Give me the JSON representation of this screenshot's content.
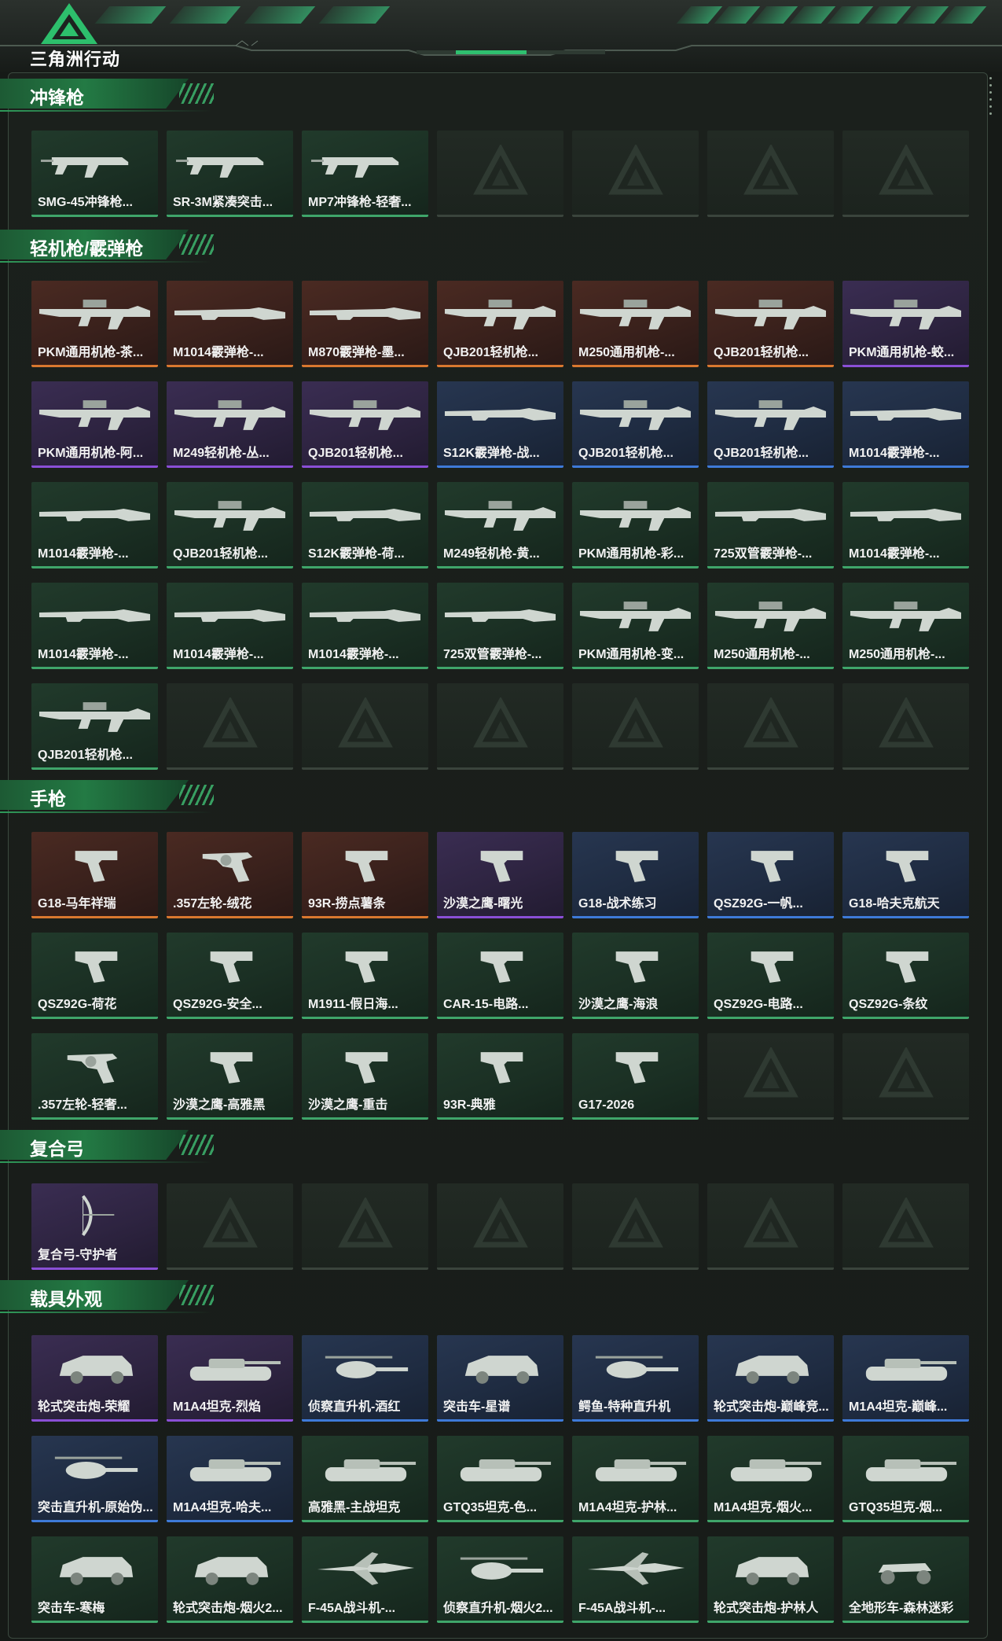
{
  "header": {
    "logo_text": "三角洲行动",
    "logo_icon": "delta-triangle-icon"
  },
  "colors": {
    "orange": "#d9782f",
    "purple": "#8a4fd6",
    "blue": "#3e7ad8",
    "green": "#3fa56a",
    "accent": "#237a44"
  },
  "sections": [
    {
      "title": "冲锋枪",
      "items": [
        {
          "name": "SMG-45冲锋枪...",
          "rarity": "green",
          "icon": "smg-icon"
        },
        {
          "name": "SR-3M紧凑突击...",
          "rarity": "green",
          "icon": "smg-icon"
        },
        {
          "name": "MP7冲锋枪-轻奢...",
          "rarity": "green",
          "icon": "smg-icon"
        },
        {
          "name": "",
          "rarity": "empty"
        },
        {
          "name": "",
          "rarity": "empty"
        },
        {
          "name": "",
          "rarity": "empty"
        },
        {
          "name": "",
          "rarity": "empty"
        }
      ]
    },
    {
      "title": "轻机枪/霰弹枪",
      "items": [
        {
          "name": "PKM通用机枪-茶...",
          "rarity": "orange",
          "icon": "machine-gun-icon"
        },
        {
          "name": "M1014霰弹枪-...",
          "rarity": "orange",
          "icon": "shotgun-icon"
        },
        {
          "name": "M870霰弹枪-墨...",
          "rarity": "orange",
          "icon": "shotgun-icon"
        },
        {
          "name": "QJB201轻机枪...",
          "rarity": "orange",
          "icon": "machine-gun-icon"
        },
        {
          "name": "M250通用机枪-...",
          "rarity": "orange",
          "icon": "machine-gun-icon"
        },
        {
          "name": "QJB201轻机枪...",
          "rarity": "orange",
          "icon": "machine-gun-icon"
        },
        {
          "name": "PKM通用机枪-蛟...",
          "rarity": "purple",
          "icon": "machine-gun-icon"
        },
        {
          "name": "PKM通用机枪-阿...",
          "rarity": "purple",
          "icon": "machine-gun-icon"
        },
        {
          "name": "M249轻机枪-丛...",
          "rarity": "purple",
          "icon": "machine-gun-icon"
        },
        {
          "name": "QJB201轻机枪...",
          "rarity": "purple",
          "icon": "machine-gun-icon"
        },
        {
          "name": "S12K霰弹枪-战...",
          "rarity": "blue",
          "icon": "shotgun-icon"
        },
        {
          "name": "QJB201轻机枪...",
          "rarity": "blue",
          "icon": "machine-gun-icon"
        },
        {
          "name": "QJB201轻机枪...",
          "rarity": "blue",
          "icon": "machine-gun-icon"
        },
        {
          "name": "M1014霰弹枪-...",
          "rarity": "blue",
          "icon": "shotgun-icon"
        },
        {
          "name": "M1014霰弹枪-...",
          "rarity": "green",
          "icon": "shotgun-icon"
        },
        {
          "name": "QJB201轻机枪...",
          "rarity": "green",
          "icon": "machine-gun-icon"
        },
        {
          "name": "S12K霰弹枪-荷...",
          "rarity": "green",
          "icon": "shotgun-icon"
        },
        {
          "name": "M249轻机枪-黄...",
          "rarity": "green",
          "icon": "machine-gun-icon"
        },
        {
          "name": "PKM通用机枪-彩...",
          "rarity": "green",
          "icon": "machine-gun-icon"
        },
        {
          "name": "725双管霰弹枪-...",
          "rarity": "green",
          "icon": "shotgun-icon"
        },
        {
          "name": "M1014霰弹枪-...",
          "rarity": "green",
          "icon": "shotgun-icon"
        },
        {
          "name": "M1014霰弹枪-...",
          "rarity": "green",
          "icon": "shotgun-icon"
        },
        {
          "name": "M1014霰弹枪-...",
          "rarity": "green",
          "icon": "shotgun-icon"
        },
        {
          "name": "M1014霰弹枪-...",
          "rarity": "green",
          "icon": "shotgun-icon"
        },
        {
          "name": "725双管霰弹枪-...",
          "rarity": "green",
          "icon": "shotgun-icon"
        },
        {
          "name": "PKM通用机枪-变...",
          "rarity": "green",
          "icon": "machine-gun-icon"
        },
        {
          "name": "M250通用机枪-...",
          "rarity": "green",
          "icon": "machine-gun-icon"
        },
        {
          "name": "M250通用机枪-...",
          "rarity": "green",
          "icon": "machine-gun-icon"
        },
        {
          "name": "QJB201轻机枪...",
          "rarity": "green",
          "icon": "machine-gun-icon"
        },
        {
          "name": "",
          "rarity": "empty"
        },
        {
          "name": "",
          "rarity": "empty"
        },
        {
          "name": "",
          "rarity": "empty"
        },
        {
          "name": "",
          "rarity": "empty"
        },
        {
          "name": "",
          "rarity": "empty"
        },
        {
          "name": "",
          "rarity": "empty"
        }
      ]
    },
    {
      "title": "手枪",
      "items": [
        {
          "name": "G18-马年祥瑞",
          "rarity": "orange",
          "icon": "pistol-icon"
        },
        {
          "name": ".357左轮-绒花",
          "rarity": "orange",
          "icon": "revolver-icon"
        },
        {
          "name": "93R-捞点薯条",
          "rarity": "orange",
          "icon": "pistol-icon"
        },
        {
          "name": "沙漠之鹰-曙光",
          "rarity": "purple",
          "icon": "pistol-icon"
        },
        {
          "name": "G18-战术练习",
          "rarity": "blue",
          "icon": "pistol-icon"
        },
        {
          "name": "QSZ92G-一帆...",
          "rarity": "blue",
          "icon": "pistol-icon"
        },
        {
          "name": "G18-哈夫克航天",
          "rarity": "blue",
          "icon": "pistol-icon"
        },
        {
          "name": "QSZ92G-荷花",
          "rarity": "green",
          "icon": "pistol-icon"
        },
        {
          "name": "QSZ92G-安全...",
          "rarity": "green",
          "icon": "pistol-icon"
        },
        {
          "name": "M1911-假日海...",
          "rarity": "green",
          "icon": "pistol-icon"
        },
        {
          "name": "CAR-15-电路...",
          "rarity": "green",
          "icon": "pistol-icon"
        },
        {
          "name": "沙漠之鹰-海浪",
          "rarity": "green",
          "icon": "pistol-icon"
        },
        {
          "name": "QSZ92G-电路...",
          "rarity": "green",
          "icon": "pistol-icon"
        },
        {
          "name": "QSZ92G-条纹",
          "rarity": "green",
          "icon": "pistol-icon"
        },
        {
          "name": ".357左轮-轻奢...",
          "rarity": "green",
          "icon": "revolver-icon"
        },
        {
          "name": "沙漠之鹰-高雅黑",
          "rarity": "green",
          "icon": "pistol-icon"
        },
        {
          "name": "沙漠之鹰-重击",
          "rarity": "green",
          "icon": "pistol-icon"
        },
        {
          "name": "93R-典雅",
          "rarity": "green",
          "icon": "pistol-icon"
        },
        {
          "name": "G17-2026",
          "rarity": "green",
          "icon": "pistol-icon"
        },
        {
          "name": "",
          "rarity": "empty"
        },
        {
          "name": "",
          "rarity": "empty"
        }
      ]
    },
    {
      "title": "复合弓",
      "items": [
        {
          "name": "复合弓-守护者",
          "rarity": "purple",
          "icon": "bow-icon"
        },
        {
          "name": "",
          "rarity": "empty"
        },
        {
          "name": "",
          "rarity": "empty"
        },
        {
          "name": "",
          "rarity": "empty"
        },
        {
          "name": "",
          "rarity": "empty"
        },
        {
          "name": "",
          "rarity": "empty"
        },
        {
          "name": "",
          "rarity": "empty"
        }
      ]
    },
    {
      "title": "载具外观",
      "items": [
        {
          "name": "轮式突击炮-荣耀",
          "rarity": "purple",
          "icon": "armored-car-icon"
        },
        {
          "name": "M1A4坦克-烈焰",
          "rarity": "purple",
          "icon": "tank-icon"
        },
        {
          "name": "侦察直升机-酒红",
          "rarity": "blue",
          "icon": "helicopter-icon"
        },
        {
          "name": "突击车-星谱",
          "rarity": "blue",
          "icon": "armored-car-icon"
        },
        {
          "name": "鳄鱼-特种直升机",
          "rarity": "blue",
          "icon": "helicopter-icon"
        },
        {
          "name": "轮式突击炮-巅峰竞...",
          "rarity": "blue",
          "icon": "armored-car-icon"
        },
        {
          "name": "M1A4坦克-巅峰...",
          "rarity": "blue",
          "icon": "tank-icon"
        },
        {
          "name": "突击直升机-原始伪...",
          "rarity": "blue",
          "icon": "helicopter-icon"
        },
        {
          "name": "M1A4坦克-哈夫...",
          "rarity": "blue",
          "icon": "tank-icon"
        },
        {
          "name": "高雅黑-主战坦克",
          "rarity": "green",
          "icon": "tank-icon"
        },
        {
          "name": "GTQ35坦克-色...",
          "rarity": "green",
          "icon": "tank-icon"
        },
        {
          "name": "M1A4坦克-护林...",
          "rarity": "green",
          "icon": "tank-icon"
        },
        {
          "name": "M1A4坦克-烟火...",
          "rarity": "green",
          "icon": "tank-icon"
        },
        {
          "name": "GTQ35坦克-烟...",
          "rarity": "green",
          "icon": "tank-icon"
        },
        {
          "name": "突击车-寒梅",
          "rarity": "green",
          "icon": "armored-car-icon"
        },
        {
          "name": "轮式突击炮-烟火2...",
          "rarity": "green",
          "icon": "armored-car-icon"
        },
        {
          "name": "F-45A战斗机-...",
          "rarity": "green",
          "icon": "jet-icon"
        },
        {
          "name": "侦察直升机-烟火2...",
          "rarity": "green",
          "icon": "helicopter-icon"
        },
        {
          "name": "F-45A战斗机-...",
          "rarity": "green",
          "icon": "jet-icon"
        },
        {
          "name": "轮式突击炮-护林人",
          "rarity": "green",
          "icon": "armored-car-icon"
        },
        {
          "name": "全地形车-森林迷彩",
          "rarity": "green",
          "icon": "atv-icon"
        }
      ]
    }
  ]
}
